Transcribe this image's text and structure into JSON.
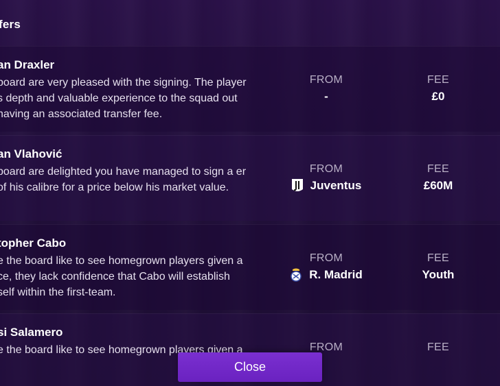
{
  "section_title": "fers",
  "transfers": [
    {
      "name": "an Draxler",
      "description": "board are very pleased with the signing. The player s depth and valuable experience to the squad out having an associated transfer fee.",
      "from_label": "FROM",
      "from_value": "-",
      "from_badge": "",
      "fee_label": "FEE",
      "fee_value": "£0"
    },
    {
      "name": "an Vlahović",
      "description": "board are delighted you have managed to sign a er of his calibre for a price below his market value.",
      "from_label": "FROM",
      "from_value": "Juventus",
      "from_badge": "juventus-badge-icon",
      "fee_label": "FEE",
      "fee_value": "£60M"
    },
    {
      "name": "topher Cabo",
      "description": "e the board like to see homegrown players given a ce, they lack confidence that Cabo will establish self within the first-team.",
      "from_label": "FROM",
      "from_value": "R. Madrid",
      "from_badge": "real-madrid-badge-icon",
      "fee_label": "FEE",
      "fee_value": "Youth"
    },
    {
      "name": "si Salamero",
      "description": "e the board like to see homegrown players given a",
      "from_label": "FROM",
      "from_value": "",
      "from_badge": "",
      "fee_label": "FEE",
      "fee_value": ""
    }
  ],
  "close_label": "Close",
  "colors": {
    "accent": "#7a2fd0",
    "background": "#22103c"
  }
}
